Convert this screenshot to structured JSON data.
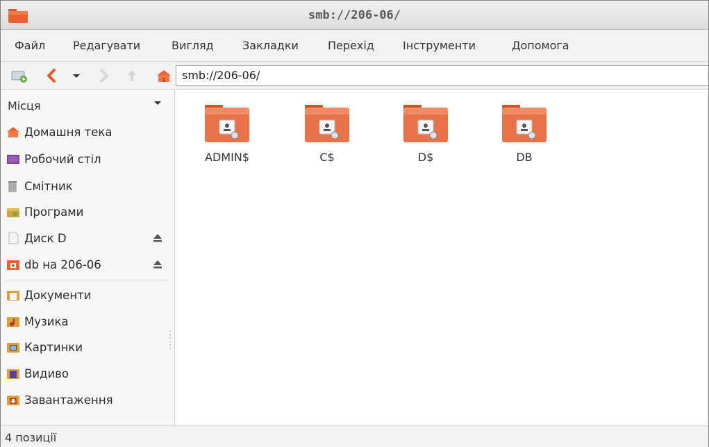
{
  "window": {
    "title": "smb://206-06/"
  },
  "menu": [
    {
      "label": "Файл"
    },
    {
      "label": "Редагувати"
    },
    {
      "label": "Вигляд"
    },
    {
      "label": "Закладки"
    },
    {
      "label": "Перехід"
    },
    {
      "label": "Інструменти"
    },
    {
      "label": "Допомога"
    }
  ],
  "toolbar": {
    "location": "smb://206-06/"
  },
  "sidebar": {
    "header": "Місця",
    "items": [
      {
        "label": "Домашня тека",
        "icon": "home-folder-icon"
      },
      {
        "label": "Робочий стіл",
        "icon": "desktop-icon"
      },
      {
        "label": "Смітник",
        "icon": "trash-icon"
      },
      {
        "label": "Програми",
        "icon": "applications-icon"
      },
      {
        "label": "Диск D",
        "icon": "drive-icon",
        "eject": true
      },
      {
        "label": "db на 206-06",
        "icon": "network-share-icon",
        "eject": true
      },
      {
        "label": "Документи",
        "icon": "documents-icon"
      },
      {
        "label": "Музика",
        "icon": "music-icon"
      },
      {
        "label": "Картинки",
        "icon": "pictures-icon"
      },
      {
        "label": "Видиво",
        "icon": "videos-icon"
      },
      {
        "label": "Завантаження",
        "icon": "downloads-icon"
      }
    ]
  },
  "files": [
    {
      "name": "ADMIN$",
      "icon": "network-folder-icon"
    },
    {
      "name": "C$",
      "icon": "network-folder-icon"
    },
    {
      "name": "D$",
      "icon": "network-folder-icon"
    },
    {
      "name": "DB",
      "icon": "network-folder-icon"
    }
  ],
  "status": {
    "text": "4 позиції"
  },
  "colors": {
    "accent": "#e9622f",
    "folder": "#e8734a"
  }
}
